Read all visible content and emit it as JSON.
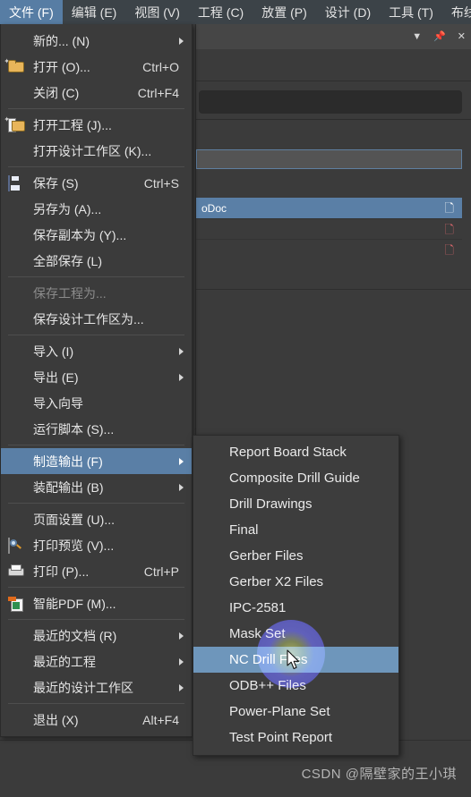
{
  "menubar": {
    "items": [
      {
        "label": "文件 (F)",
        "mnemonic": "F",
        "active": true
      },
      {
        "label": "编辑 (E)",
        "mnemonic": "E",
        "active": false
      },
      {
        "label": "视图 (V)",
        "mnemonic": "V",
        "active": false
      },
      {
        "label": "工程 (C)",
        "mnemonic": "C",
        "active": false
      },
      {
        "label": "放置 (P)",
        "mnemonic": "P",
        "active": false
      },
      {
        "label": "设计 (D)",
        "mnemonic": "D",
        "active": false
      },
      {
        "label": "工具 (T)",
        "mnemonic": "T",
        "active": false
      },
      {
        "label": "布线",
        "mnemonic": "",
        "active": false
      }
    ]
  },
  "panel": {
    "header_icons": [
      "dropdown-arrow-icon",
      "pin-icon",
      "close-icon"
    ],
    "documents": [
      {
        "label": "oDoc",
        "selected": true,
        "page_icon": "page-icon-white"
      },
      {
        "label": "",
        "selected": false,
        "page_icon": "page-icon-red"
      },
      {
        "label": "",
        "selected": false,
        "page_icon": "page-icon-red"
      }
    ]
  },
  "file_menu": {
    "items": [
      {
        "label": "新的... (N)",
        "accel": "",
        "icon": "",
        "arrow": true,
        "disabled": false,
        "highlight": false,
        "sep_after": false
      },
      {
        "label": "打开 (O)...",
        "accel": "Ctrl+O",
        "icon": "folder-open-icon",
        "arrow": false,
        "disabled": false,
        "highlight": false,
        "sep_after": false
      },
      {
        "label": "关闭 (C)",
        "accel": "Ctrl+F4",
        "icon": "",
        "arrow": false,
        "disabled": false,
        "highlight": false,
        "sep_after": true
      },
      {
        "label": "打开工程 (J)...",
        "accel": "",
        "icon": "folder-project-icon",
        "arrow": false,
        "disabled": false,
        "highlight": false,
        "sep_after": false
      },
      {
        "label": "打开设计工作区 (K)...",
        "accel": "",
        "icon": "",
        "arrow": false,
        "disabled": false,
        "highlight": false,
        "sep_after": true
      },
      {
        "label": "保存 (S)",
        "accel": "Ctrl+S",
        "icon": "save-icon",
        "arrow": false,
        "disabled": false,
        "highlight": false,
        "sep_after": false
      },
      {
        "label": "另存为 (A)...",
        "accel": "",
        "icon": "",
        "arrow": false,
        "disabled": false,
        "highlight": false,
        "sep_after": false
      },
      {
        "label": "保存副本为 (Y)...",
        "accel": "",
        "icon": "",
        "arrow": false,
        "disabled": false,
        "highlight": false,
        "sep_after": false
      },
      {
        "label": "全部保存 (L)",
        "accel": "",
        "icon": "",
        "arrow": false,
        "disabled": false,
        "highlight": false,
        "sep_after": true
      },
      {
        "label": "保存工程为...",
        "accel": "",
        "icon": "",
        "arrow": false,
        "disabled": true,
        "highlight": false,
        "sep_after": false
      },
      {
        "label": "保存设计工作区为...",
        "accel": "",
        "icon": "",
        "arrow": false,
        "disabled": false,
        "highlight": false,
        "sep_after": true
      },
      {
        "label": "导入 (I)",
        "accel": "",
        "icon": "",
        "arrow": true,
        "disabled": false,
        "highlight": false,
        "sep_after": false
      },
      {
        "label": "导出 (E)",
        "accel": "",
        "icon": "",
        "arrow": true,
        "disabled": false,
        "highlight": false,
        "sep_after": false
      },
      {
        "label": "导入向导",
        "accel": "",
        "icon": "",
        "arrow": false,
        "disabled": false,
        "highlight": false,
        "sep_after": false
      },
      {
        "label": "运行脚本 (S)...",
        "accel": "",
        "icon": "",
        "arrow": false,
        "disabled": false,
        "highlight": false,
        "sep_after": true
      },
      {
        "label": "制造输出 (F)",
        "accel": "",
        "icon": "",
        "arrow": true,
        "disabled": false,
        "highlight": true,
        "sep_after": false
      },
      {
        "label": "装配输出 (B)",
        "accel": "",
        "icon": "",
        "arrow": true,
        "disabled": false,
        "highlight": false,
        "sep_after": true
      },
      {
        "label": "页面设置 (U)...",
        "accel": "",
        "icon": "",
        "arrow": false,
        "disabled": false,
        "highlight": false,
        "sep_after": false
      },
      {
        "label": "打印预览 (V)...",
        "accel": "",
        "icon": "print-preview-icon",
        "arrow": false,
        "disabled": false,
        "highlight": false,
        "sep_after": false
      },
      {
        "label": "打印 (P)...",
        "accel": "Ctrl+P",
        "icon": "printer-icon",
        "arrow": false,
        "disabled": false,
        "highlight": false,
        "sep_after": true
      },
      {
        "label": "智能PDF (M)...",
        "accel": "",
        "icon": "smart-pdf-icon",
        "arrow": false,
        "disabled": false,
        "highlight": false,
        "sep_after": true
      },
      {
        "label": "最近的文档 (R)",
        "accel": "",
        "icon": "",
        "arrow": true,
        "disabled": false,
        "highlight": false,
        "sep_after": false
      },
      {
        "label": "最近的工程",
        "accel": "",
        "icon": "",
        "arrow": true,
        "disabled": false,
        "highlight": false,
        "sep_after": false
      },
      {
        "label": "最近的设计工作区",
        "accel": "",
        "icon": "",
        "arrow": true,
        "disabled": false,
        "highlight": false,
        "sep_after": true
      },
      {
        "label": "退出 (X)",
        "accel": "Alt+F4",
        "icon": "",
        "arrow": false,
        "disabled": false,
        "highlight": false,
        "sep_after": false
      }
    ]
  },
  "fabrication_submenu": {
    "items": [
      {
        "label": "Report Board Stack",
        "highlight": false
      },
      {
        "label": "Composite Drill Guide",
        "highlight": false
      },
      {
        "label": "Drill Drawings",
        "highlight": false
      },
      {
        "label": "Final",
        "highlight": false
      },
      {
        "label": "Gerber Files",
        "highlight": false
      },
      {
        "label": "Gerber X2 Files",
        "highlight": false
      },
      {
        "label": "IPC-2581",
        "highlight": false
      },
      {
        "label": "Mask Set",
        "highlight": false
      },
      {
        "label": "NC Drill Files",
        "highlight": true
      },
      {
        "label": "ODB++ Files",
        "highlight": false
      },
      {
        "label": "Power-Plane Set",
        "highlight": false
      },
      {
        "label": "Test Point Report",
        "highlight": false
      }
    ]
  },
  "watermark": {
    "text": "CSDN @隔壁家的王小琪"
  },
  "colors": {
    "window_bg": "#3b3b3b",
    "menu_bg": "#3b3b3b",
    "submenu_bg": "#3d3d3d",
    "highlight": "#5a7fa6",
    "submenu_highlight": "#6e96bb",
    "text": "#e6e6e6",
    "disabled_text": "#8b8b8b",
    "menubar_bg": "#3c4348",
    "doc_selected": "#5a7fa6",
    "page_icon_red": "#d9676b"
  }
}
